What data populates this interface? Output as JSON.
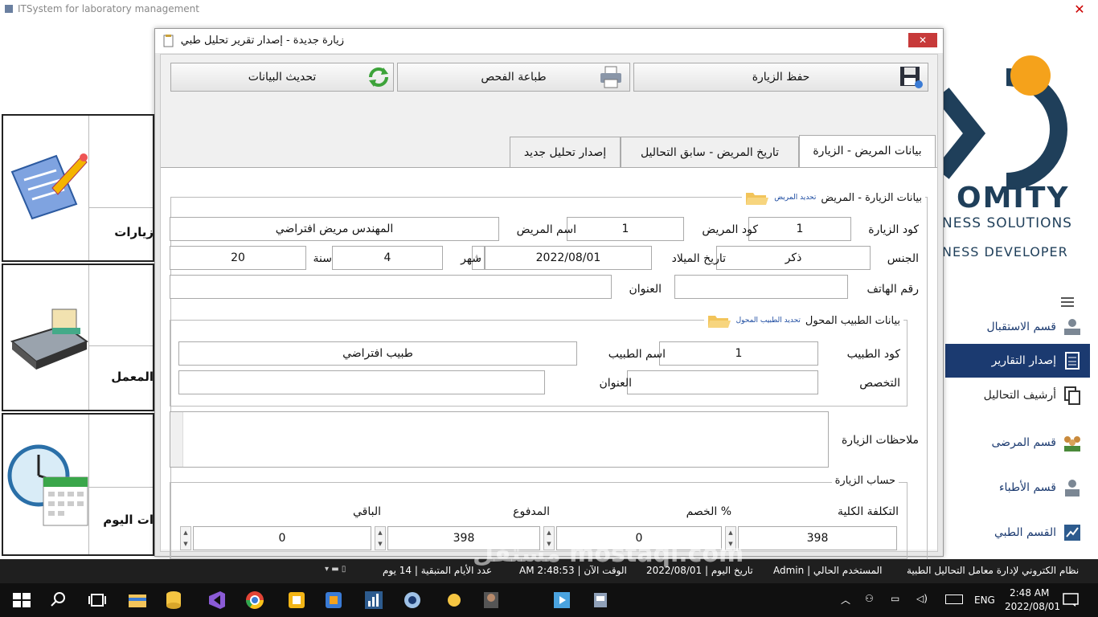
{
  "window": {
    "title": "ITSystem for laboratory management"
  },
  "left_panels": [
    {
      "label": "زيارات"
    },
    {
      "label": "المعمل"
    },
    {
      "label": "ات اليوم"
    }
  ],
  "logo": {
    "brand": "OMITY",
    "tag1": "NESS SOLUTIONS",
    "tag2": "NESS DEVELOPER"
  },
  "nav": [
    {
      "label": "قسم الاستقبال"
    },
    {
      "label": "إصدار التقارير"
    },
    {
      "label": "أرشيف التحاليل"
    },
    {
      "label": "قسم المرضى"
    },
    {
      "label": "قسم الأطباء"
    },
    {
      "label": "القسم الطبي"
    }
  ],
  "dialog": {
    "title": "زيارة جديدة - إصدار تقرير تحليل طبي",
    "toolbar": {
      "save": "حفظ الزيارة",
      "print": "طباعة الفحص",
      "refresh": "تحديث البيانات"
    },
    "tabs": [
      "بيانات المريض - الزيارة",
      "تاريخ المريض - سابق التحاليل",
      "إصدار تحليل جديد"
    ],
    "visit_group": {
      "title": "بيانات الزيارة - المريض",
      "link": "تحديد المريض",
      "visit_code_label": "كود الزيارة",
      "visit_code": "1",
      "patient_code_label": "كود المريض",
      "patient_code": "1",
      "patient_name_label": "اسم المريض",
      "patient_name": "المهندس مريض افتراضي",
      "gender_label": "الجنس",
      "gender": "ذكر",
      "dob_label": "تاريخ الميلاد",
      "dob": "2022/08/01",
      "month_label": "شهر",
      "month": "4",
      "year_label": "سنة",
      "year": "20",
      "phone_label": "رقم الهاتف",
      "phone": "",
      "address_label": "العنوان",
      "address": ""
    },
    "doctor_group": {
      "title": "بيانات الطبيب المحول",
      "link": "تحديد الطبيب المحول",
      "code_label": "كود الطبيب",
      "code": "1",
      "name_label": "اسم الطبيب",
      "name": "طبيب افتراضي",
      "spec_label": "التخصص",
      "spec": "",
      "address_label": "العنوان",
      "address": ""
    },
    "notes_label": "ملاحظات الزيارة",
    "account": {
      "title": "حساب الزيارة",
      "total_label": "التكلفة الكلية",
      "total": "398",
      "discount_label": "% الخصم",
      "discount": "0",
      "paid_label": "المدفوع",
      "paid": "398",
      "remaining_label": "الباقي",
      "remaining": "0"
    }
  },
  "status": {
    "system": "نظام الكتروني لإدارة معامل التحاليل الطبية",
    "user": "المستخدم الحالي | Admin",
    "date": "تاريخ اليوم | 2022/08/01",
    "time": "الوقت الآن | 2:48:53 AM",
    "days": "عدد الأيام المتبقية | 14 يوم"
  },
  "taskbar": {
    "lang": "ENG",
    "time": "2:48 AM",
    "date": "2022/08/01"
  },
  "watermark": "مستقل mostaql.com"
}
